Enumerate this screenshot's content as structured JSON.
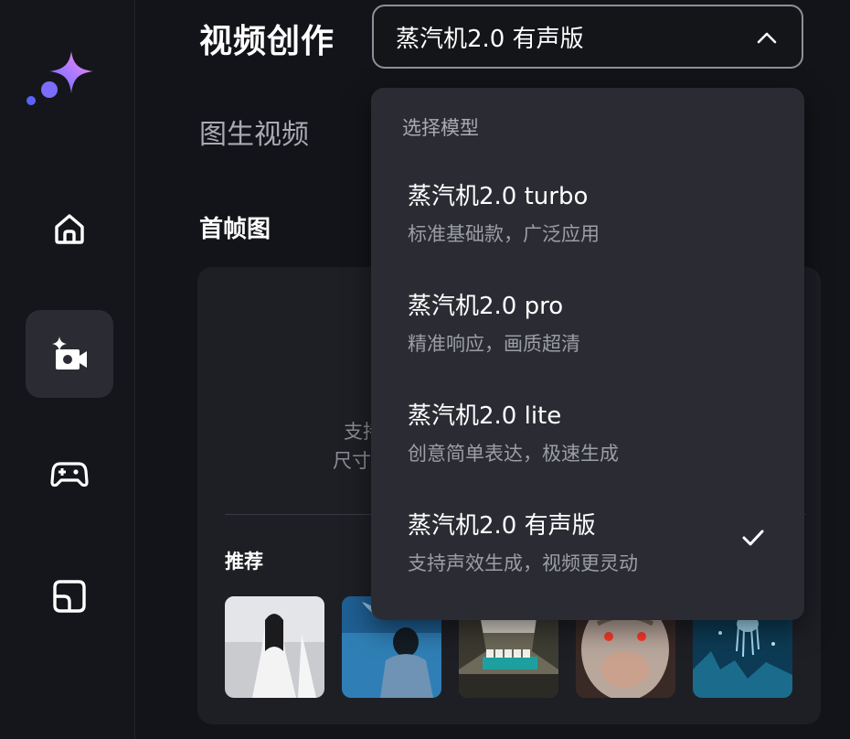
{
  "app": {
    "title": "视频创作",
    "logo": "sparkle-logo"
  },
  "sidebar": {
    "items": [
      {
        "name": "home",
        "icon": "home-icon",
        "active": false
      },
      {
        "name": "video",
        "icon": "video-sparkle-icon",
        "active": true
      },
      {
        "name": "game",
        "icon": "gamepad-icon",
        "active": false
      },
      {
        "name": "gallery",
        "icon": "gallery-icon",
        "active": false
      }
    ]
  },
  "model_select": {
    "value": "蒸汽机2.0 有声版",
    "icon": "chevron-up-icon"
  },
  "main": {
    "section_title": "图生视频",
    "frame_title": "首帧图",
    "upload_hint_line1": "支持J",
    "upload_hint_line2": "尺寸不",
    "recommend_title": "推荐",
    "thumbnails": [
      {
        "alt": "white-robed-figure"
      },
      {
        "alt": "woman-by-sea"
      },
      {
        "alt": "mahjong-scene"
      },
      {
        "alt": "monkey-king-face"
      },
      {
        "alt": "underwater-jellyfish"
      }
    ]
  },
  "dropdown": {
    "header": "选择模型",
    "options": [
      {
        "name": "蒸汽机2.0 turbo",
        "desc": "标准基础款，广泛应用",
        "selected": false
      },
      {
        "name": "蒸汽机2.0 pro",
        "desc": "精准响应，画质超清",
        "selected": false
      },
      {
        "name": "蒸汽机2.0 lite",
        "desc": "创意简单表达，极速生成",
        "selected": false
      },
      {
        "name": "蒸汽机2.0 有声版",
        "desc": "支持声效生成，视频更灵动",
        "selected": true
      }
    ],
    "check_icon": "checkmark-icon"
  },
  "colors": {
    "background": "#111217",
    "panel": "#2b2c33",
    "accent_gradient": [
      "#6b6cff",
      "#ff7ad9"
    ]
  }
}
